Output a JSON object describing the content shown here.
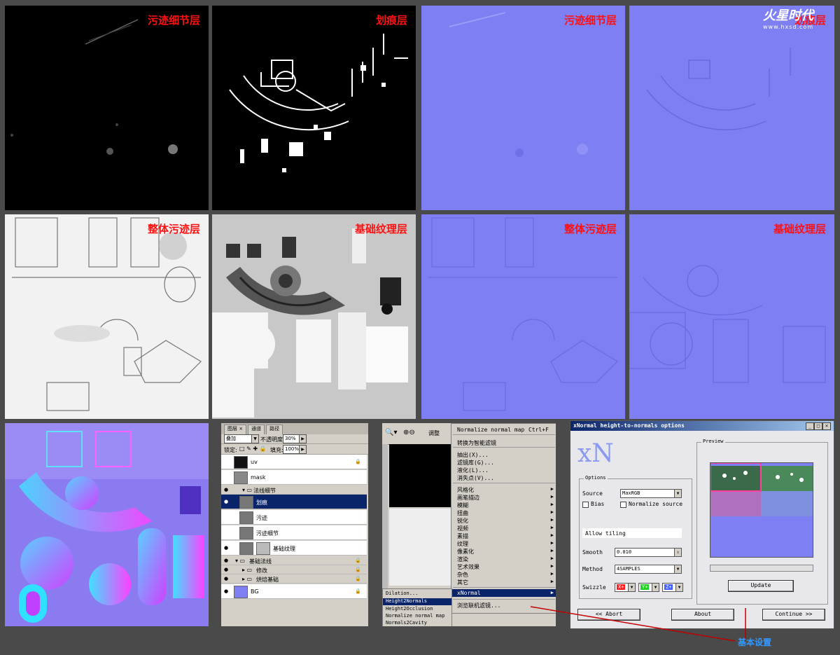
{
  "brand": {
    "logo_text": "火星时代",
    "logo_url": "www.hxsd.com"
  },
  "labels": {
    "dirt_detail": "污迹细节层",
    "scratch": "划痕层",
    "overall_dirt": "整体污迹层",
    "base_texture": "基础纹理层"
  },
  "colors": {
    "label_red": "#ff1010",
    "normal_blue": "#7f7ff4",
    "annotation": "#3399ff"
  },
  "layers_panel": {
    "tabs": [
      "图层 ×",
      "通道",
      "路径"
    ],
    "blend_mode": "叠加",
    "opacity_label": "不透明度:",
    "opacity_value": "30%",
    "lock_label": "锁定:",
    "fill_label": "填充:",
    "fill_value": "100%",
    "layers": [
      {
        "name": "uv"
      },
      {
        "name": "mask"
      },
      {
        "name": "法线细节"
      },
      {
        "name": "划痕"
      },
      {
        "name": "污迹"
      },
      {
        "name": "污迹细节"
      },
      {
        "name": "基础纹理"
      },
      {
        "name": "基础法线"
      },
      {
        "name": "修改"
      },
      {
        "name": "烘焙基础"
      },
      {
        "name": "BG"
      }
    ]
  },
  "filter_menu": {
    "toolbar_label": "调整",
    "items": [
      {
        "label": "Normalize normal map",
        "shortcut": "Ctrl+F"
      },
      {
        "label": "转换为智能滤镜"
      },
      {
        "label": "抽出(X)..."
      },
      {
        "label": "滤镜库(G)..."
      },
      {
        "label": "液化(L)..."
      },
      {
        "label": "消失点(V)..."
      },
      {
        "label": "风格化"
      },
      {
        "label": "画笔描边"
      },
      {
        "label": "模糊"
      },
      {
        "label": "扭曲"
      },
      {
        "label": "锐化"
      },
      {
        "label": "视频"
      },
      {
        "label": "素描"
      },
      {
        "label": "纹理"
      },
      {
        "label": "像素化"
      },
      {
        "label": "渲染"
      },
      {
        "label": "艺术效果"
      },
      {
        "label": "杂色"
      },
      {
        "label": "其它"
      },
      {
        "label": "xNormal"
      },
      {
        "label": "浏览联机滤镜..."
      }
    ],
    "submenu": [
      "Dilation...",
      "Height2Normals",
      "Height2Occlusion",
      "Normalize normal map",
      "Normals2Cavity"
    ]
  },
  "xnormal_dialog": {
    "title": "xNormal height-to-normals options",
    "logo": "xN",
    "options_group": "Options",
    "preview_group": "Preview",
    "source_label": "Source",
    "source_value": "MaxRGB",
    "bias_label": "Bias",
    "normalize_source_label": "Normalize source",
    "allow_tiling_label": "Allow tiling",
    "smooth_label": "Smooth",
    "smooth_value": "0.010",
    "method_label": "Method",
    "method_value": "4SAMPLES",
    "swizzle_label": "Swizzle",
    "swizzle": [
      {
        "value": "X+",
        "color": "#ff2020"
      },
      {
        "value": "Y+",
        "color": "#20d020"
      },
      {
        "value": "Z+",
        "color": "#4060ff"
      }
    ],
    "update_button": "Update",
    "abort_button": "<< Abort",
    "about_button": "About",
    "continue_button": "Continue >>"
  },
  "annotation": "基本设置"
}
